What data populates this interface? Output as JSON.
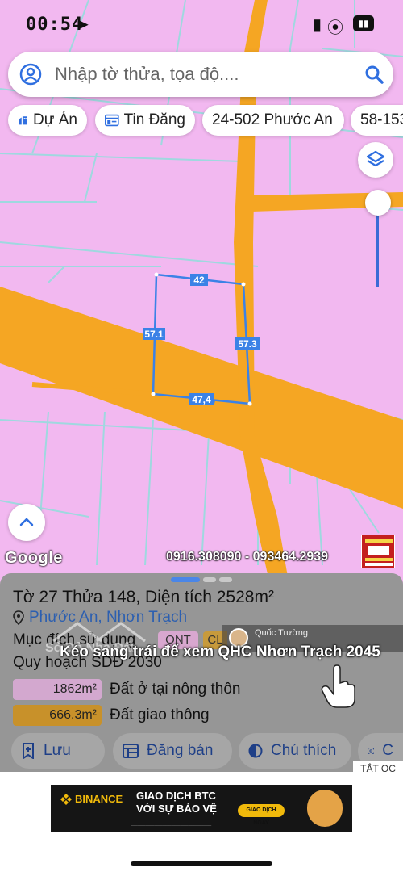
{
  "status_bar": {
    "time": "00:54"
  },
  "search": {
    "placeholder": "Nhập tờ thửa, tọa độ...."
  },
  "chips": [
    {
      "label": "Dự Án",
      "icon": "building-icon"
    },
    {
      "label": "Tin Đăng",
      "icon": "listing-icon"
    },
    {
      "label": "24-502 Phước An"
    },
    {
      "label": "58-153"
    }
  ],
  "map": {
    "parcel_edges": {
      "top": "42",
      "left": "57.1",
      "right": "57.3",
      "bottom": "47,4"
    },
    "attribution": "Google",
    "phone_overlay": "0916.308090 - 093464.2939"
  },
  "panel": {
    "title": "Tờ 27 Thửa 148, Diện tích 2528m²",
    "location": "Phước An, Nhơn Trạch",
    "purpose_label": "Mục đích sử dụng",
    "purpose_tags": [
      "ONT",
      "CL"
    ],
    "plan_label": "Quy hoạch SDĐ 2030",
    "land_uses": [
      {
        "area": "1862m²",
        "label": "Đất ở tại nông thôn",
        "color": "#d3a8cf"
      },
      {
        "area": "666.3m²",
        "label": "Đất giao thông",
        "color": "#c8912a"
      }
    ],
    "actions": [
      {
        "label": "Lưu",
        "icon": "bookmark-add-icon"
      },
      {
        "label": "Đăng bán",
        "icon": "list-icon"
      },
      {
        "label": "Chú thích",
        "icon": "legend-icon"
      },
      {
        "label": "C",
        "icon": "capture-icon"
      }
    ]
  },
  "overlay": {
    "channel_name": "Quốc Trường",
    "caption": "Kéo sang trái để xem QHC Nhơn Trạch 2045",
    "watermark": "Sổ Đỏ Nhà Đất"
  },
  "ad": {
    "close_label": "TẮT QC",
    "brand": "BINANCE",
    "headline_1": "GIAO DỊCH BTC",
    "headline_2": "VỚI SỰ BẢO VỆ",
    "cta": "GIAO DỊCH NGAY"
  },
  "colors": {
    "map_background": "#f2b8f0",
    "road": "#f5a623",
    "parcel_outline": "#3b82e6",
    "panel": "#969696",
    "accent_blue": "#2c5fb0"
  }
}
